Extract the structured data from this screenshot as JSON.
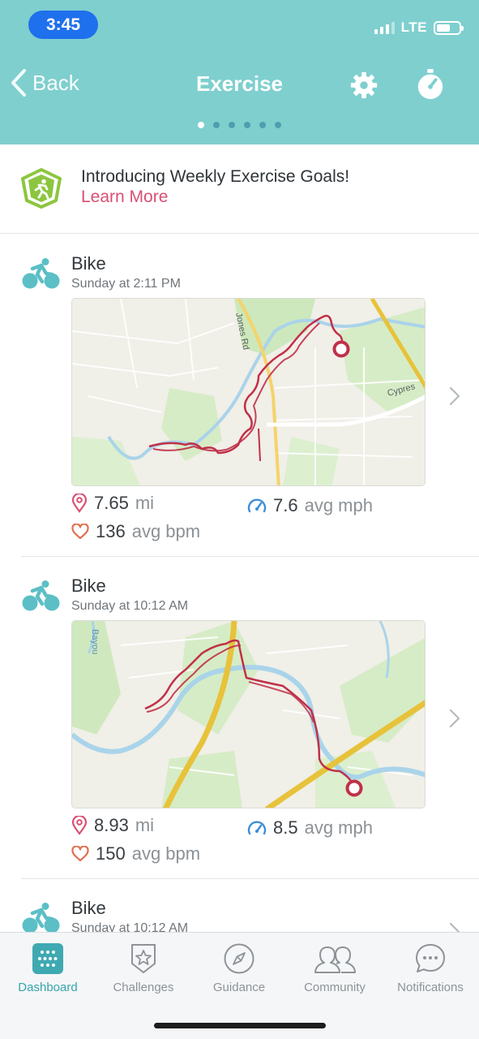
{
  "status_bar": {
    "time": "3:45",
    "network": "LTE",
    "battery_level": 0.6,
    "signal_bars": 3
  },
  "nav": {
    "back_label": "Back",
    "title": "Exercise",
    "page_count": 6,
    "active_page": 0,
    "icons": [
      "chevron-left-icon",
      "gear-icon",
      "stopwatch-icon"
    ]
  },
  "promo": {
    "title": "Introducing Weekly Exercise Goals!",
    "link": "Learn More",
    "icon": "running-goal-badge-icon"
  },
  "activities": [
    {
      "icon": "bike-icon",
      "type": "Bike",
      "when": "Sunday at 2:11 PM",
      "distance_value": "7.65",
      "distance_unit": "mi",
      "speed_value": "7.6",
      "speed_unit": "avg mph",
      "hr_value": "136",
      "hr_unit": "avg bpm",
      "map_labels": [
        "Jones Rd",
        "Cypres"
      ]
    },
    {
      "icon": "bike-icon",
      "type": "Bike",
      "when": "Sunday at 10:12 AM",
      "distance_value": "8.93",
      "distance_unit": "mi",
      "speed_value": "8.5",
      "speed_unit": "avg mph",
      "hr_value": "150",
      "hr_unit": "avg bpm",
      "map_labels": [
        "Bayou"
      ]
    },
    {
      "icon": "bike-icon",
      "type": "Bike",
      "when": "Sunday at 10:12 AM"
    }
  ],
  "tabs": [
    {
      "label": "Dashboard",
      "icon": "dashboard-grid-icon",
      "active": true
    },
    {
      "label": "Challenges",
      "icon": "star-badge-icon",
      "active": false
    },
    {
      "label": "Guidance",
      "icon": "compass-icon",
      "active": false
    },
    {
      "label": "Community",
      "icon": "people-icon",
      "active": false
    },
    {
      "label": "Notifications",
      "icon": "chat-bubble-icon",
      "active": false
    }
  ],
  "colors": {
    "header_bg": "#7fcfcf",
    "accent_teal": "#36a4ad",
    "route_red": "#c03048",
    "link_pink": "#d94f73",
    "speed_blue": "#3b8fd6",
    "heart_orange": "#e0704f",
    "time_pill": "#1f70ec"
  }
}
